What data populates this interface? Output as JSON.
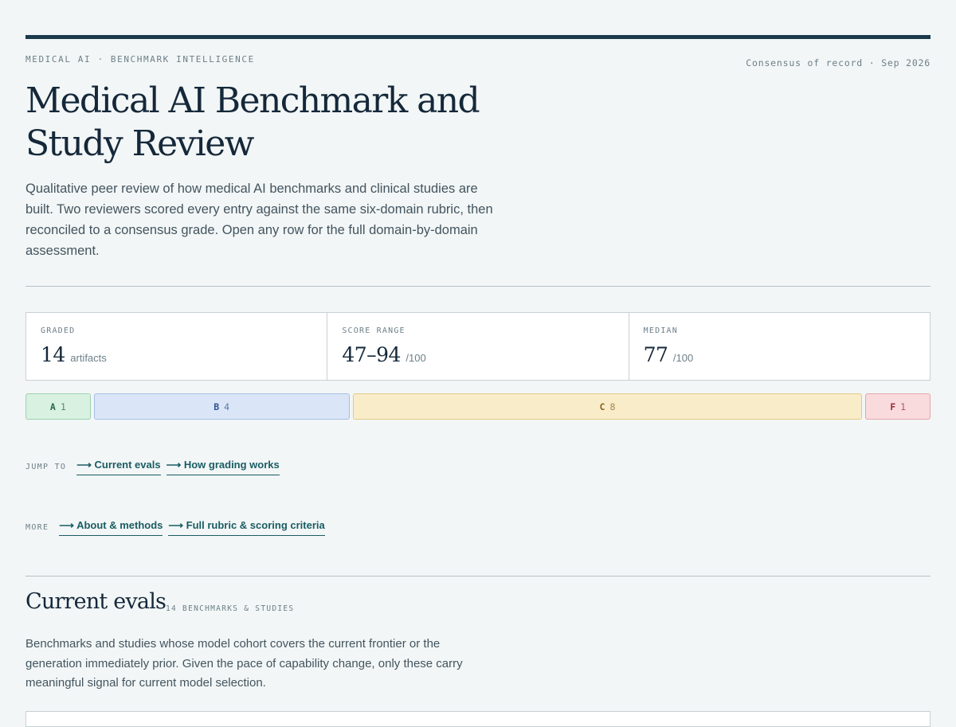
{
  "header": {
    "eyebrow": "MEDICAL AI · BENCHMARK INTELLIGENCE",
    "record": "Consensus of record · Sep 2026",
    "title": "Medical AI Benchmark and Study Review",
    "lede": "Qualitative peer review of how medical AI benchmarks and clinical studies are built. Two reviewers scored every entry against the same six-domain rubric, then reconciled to a consensus grade. Open any row for the full domain-by-domain assessment."
  },
  "stats": [
    {
      "label": "GRADED",
      "value": "14",
      "unit": "artifacts"
    },
    {
      "label": "SCORE RANGE",
      "value": "47–94",
      "unit": "/100"
    },
    {
      "label": "MEDIAN",
      "value": "77",
      "unit": "/100"
    }
  ],
  "grades": [
    {
      "letter": "A",
      "count": 1
    },
    {
      "letter": "B",
      "count": 4
    },
    {
      "letter": "C",
      "count": 8
    },
    {
      "letter": "F",
      "count": 1
    }
  ],
  "jump": {
    "label": "JUMP TO",
    "links": [
      "⟶ Current evals",
      "⟶ How grading works"
    ]
  },
  "more": {
    "label": "MORE",
    "links": [
      "⟶ About & methods",
      "⟶ Full rubric & scoring criteria"
    ]
  },
  "section": {
    "title": "Current evals",
    "meta": "14 BENCHMARKS & STUDIES",
    "description": "Benchmarks and studies whose model cohort covers the current frontier or the generation immediately prior. Given the pace of capability change, only these carry meaningful signal for current model selection."
  },
  "colors": {
    "accent": "#1b3a4b",
    "link": "#1a5c63",
    "grade_a": "#d8f1e1",
    "grade_b": "#dae6f7",
    "grade_c": "#f9ecc9",
    "grade_f": "#f9dadd"
  }
}
